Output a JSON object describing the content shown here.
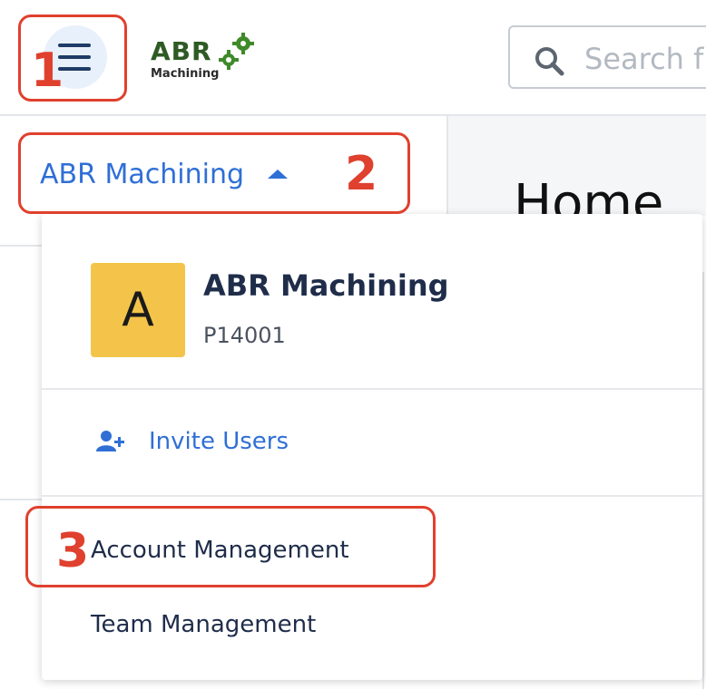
{
  "header": {
    "menu_icon": "hamburger-icon",
    "logo": {
      "abbr": "ABR",
      "sub": "Machining"
    },
    "search": {
      "placeholder": "Search f"
    }
  },
  "sidebar": {
    "org_toggle_label": "ABR Machining",
    "caret_icon": "caret-up-icon"
  },
  "main": {
    "title": "Home"
  },
  "dropdown": {
    "avatar_letter": "A",
    "org_name": "ABR Machining",
    "org_id": "P14001",
    "invite_label": "Invite Users",
    "invite_icon": "add-user-icon",
    "account_management_label": "Account Management",
    "team_management_label": "Team Management"
  },
  "annotations": {
    "step1": "1",
    "step2": "2",
    "step3": "3",
    "color": "#e0402e"
  },
  "colors": {
    "accent": "#2f6fd6",
    "avatar": "#f4c44a",
    "logo_green": "#2e5a24"
  }
}
